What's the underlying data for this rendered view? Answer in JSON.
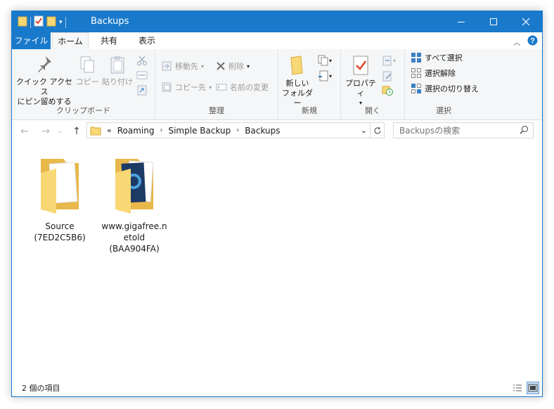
{
  "window": {
    "title": "Backups",
    "controls": [
      "minimize",
      "maximize",
      "close"
    ]
  },
  "tabs": {
    "file": "ファイル",
    "home": "ホーム",
    "share": "共有",
    "view": "表示"
  },
  "ribbon": {
    "clipboard": {
      "label": "クリップボード",
      "pin_line1": "クイック アクセス",
      "pin_line2": "にピン留めする",
      "copy": "コピー",
      "paste": "貼り付け"
    },
    "organize": {
      "label": "整理",
      "move_to": "移動先",
      "copy_to": "コピー先",
      "delete": "削除",
      "rename": "名前の変更"
    },
    "new": {
      "label": "新規",
      "new_folder_line1": "新しい",
      "new_folder_line2": "フォルダー"
    },
    "open": {
      "label": "開く",
      "properties": "プロパティ"
    },
    "select": {
      "label": "選択",
      "select_all": "すべて選択",
      "select_none": "選択解除",
      "invert": "選択の切り替え"
    }
  },
  "address": {
    "overflow": "«",
    "crumbs": [
      "Roaming",
      "Simple Backup",
      "Backups"
    ]
  },
  "search": {
    "placeholder": "Backupsの検索"
  },
  "items": [
    {
      "line1": "Source",
      "line2": "(7ED2C5B6)",
      "line3": ""
    },
    {
      "line1": "www.gigafree.n",
      "line2": "etold",
      "line3": "(BAA904FA)"
    }
  ],
  "status": {
    "count": "2 個の項目"
  },
  "colors": {
    "accent": "#1979ca",
    "folder": "#f8d775",
    "ribbon_bg": "#f5f6f7"
  }
}
